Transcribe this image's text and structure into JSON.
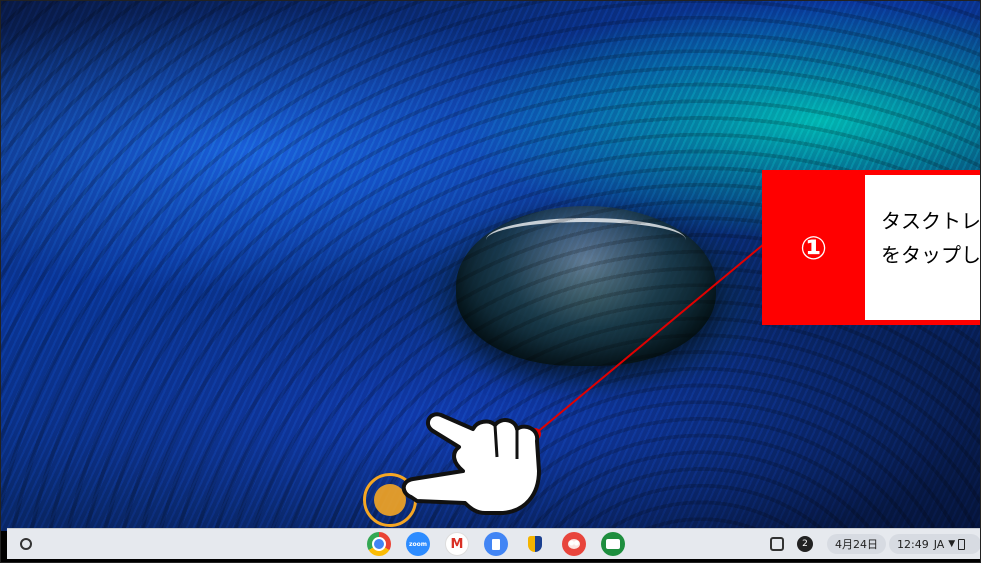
{
  "callout": {
    "number": "①",
    "line1": "タスクトレイの",
    "line2": "をタップし"
  },
  "shelf": {
    "apps": [
      {
        "name": "Chrome",
        "icon": "chrome-icon"
      },
      {
        "name": "Zoom",
        "icon": "zoom-icon",
        "label": "zoom"
      },
      {
        "name": "Gmail",
        "icon": "gmail-icon",
        "label": "M"
      },
      {
        "name": "Docs",
        "icon": "docs-icon"
      },
      {
        "name": "Shield app",
        "icon": "shield-icon"
      },
      {
        "name": "Canvas",
        "icon": "paint-icon"
      },
      {
        "name": "Classroom",
        "icon": "classroom-icon"
      }
    ],
    "tray": {
      "notification_count": "2",
      "date": "4月24日",
      "time": "12:49",
      "ime": "JA"
    }
  },
  "colors": {
    "callout_red": "#ff0000",
    "highlight_ring": "#f5a623",
    "shelf_bg": "#e6e9ee"
  }
}
